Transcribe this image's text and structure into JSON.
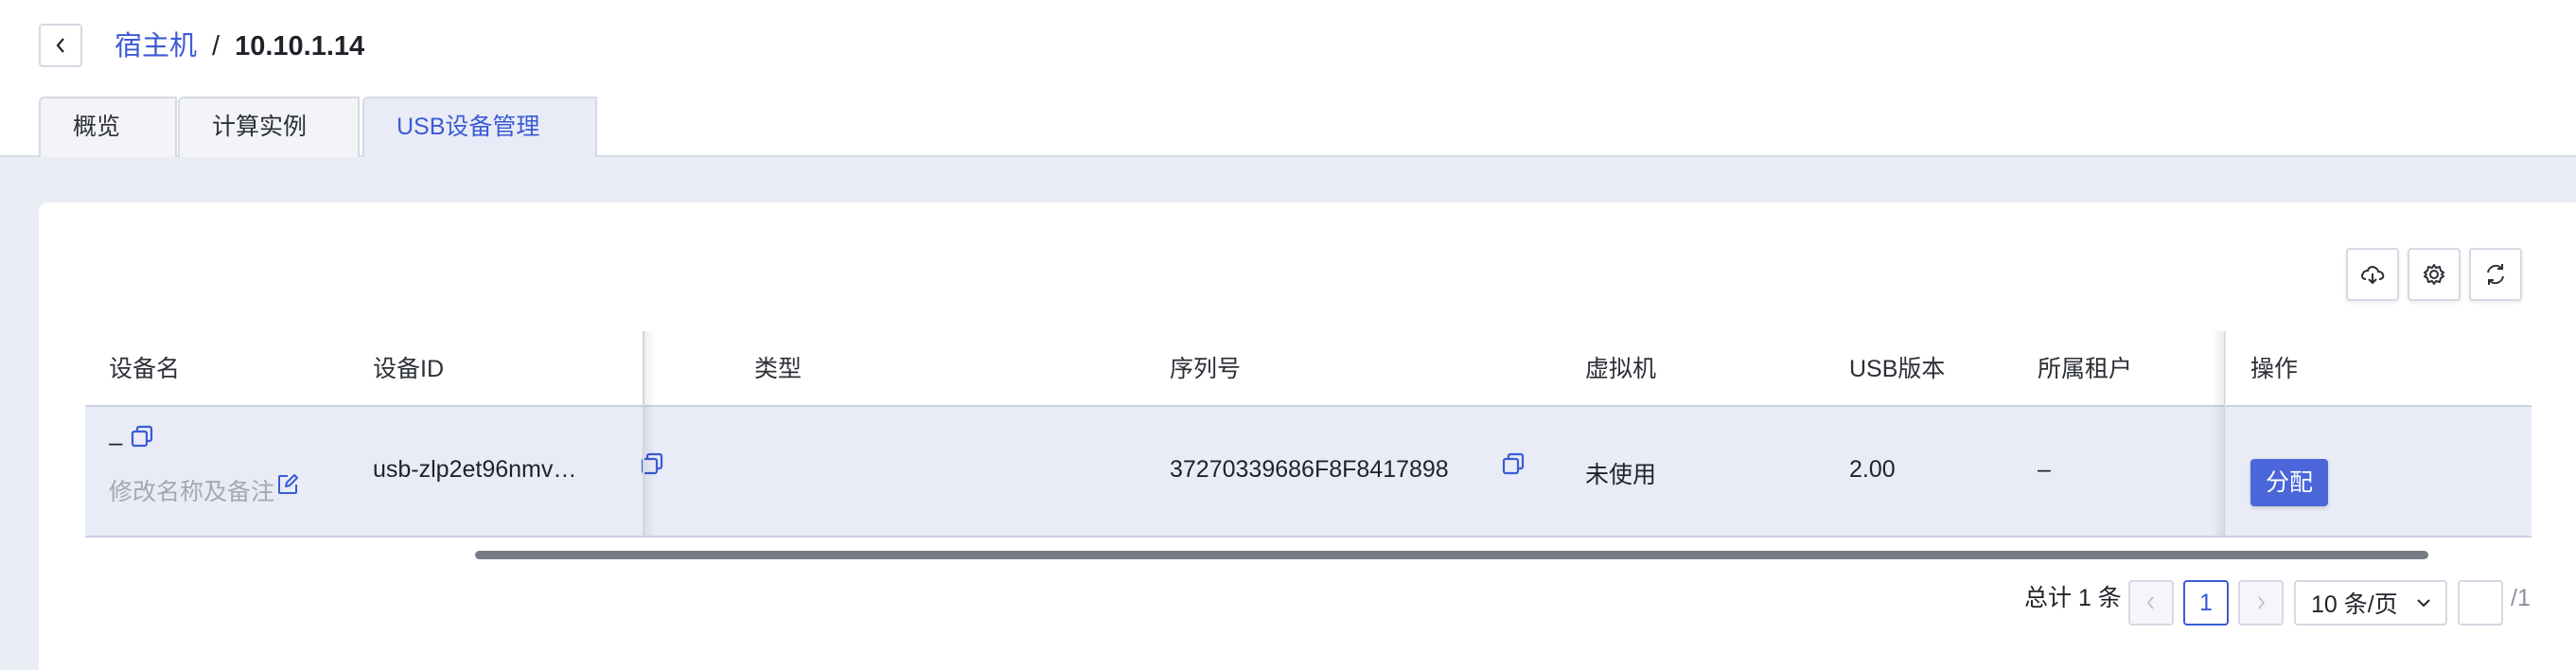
{
  "breadcrumb": {
    "parent": "宿主机",
    "separator": "/",
    "current": "10.10.1.14"
  },
  "tabs": [
    {
      "label": "概览",
      "active": false
    },
    {
      "label": "计算实例",
      "active": false
    },
    {
      "label": "USB设备管理",
      "active": true
    }
  ],
  "toolbar": {
    "icons": [
      "cloud-download-icon",
      "gear-icon",
      "refresh-icon"
    ]
  },
  "table": {
    "columns": [
      "设备名",
      "设备ID",
      "类型",
      "序列号",
      "虚拟机",
      "USB版本",
      "所属租户",
      "操作"
    ],
    "rows": [
      {
        "device_name": "–",
        "edit_label": "修改名称及备注",
        "device_id": "usb-zlp2et96nmv…",
        "type": "",
        "serial": "37270339686F8F8417898",
        "vm": "未使用",
        "usb_version": "2.00",
        "tenant": "–",
        "action": "分配"
      }
    ]
  },
  "pagination": {
    "total_label": "总计 1 条",
    "current_page": "1",
    "page_size_label": "10 条/页",
    "jump_value": "",
    "total_pages_label": "/1"
  },
  "colors": {
    "accent": "#3b5bd6",
    "button": "#4a66d8",
    "row_bg": "#e9ecf6",
    "page_bg": "#ebedf4"
  }
}
